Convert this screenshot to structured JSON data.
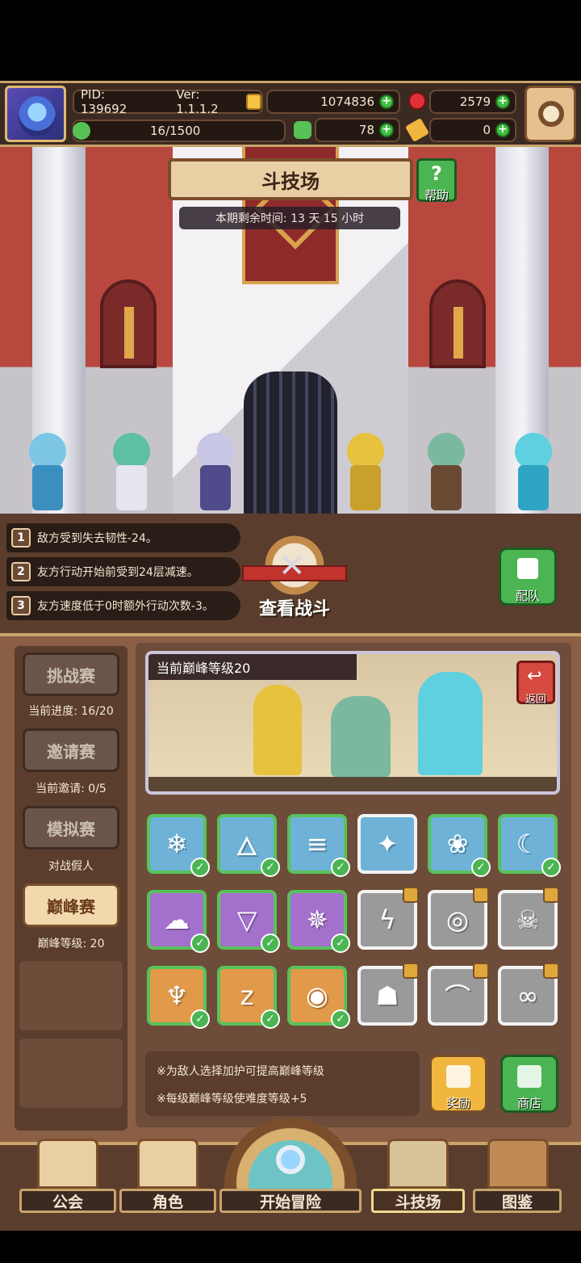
{
  "header": {
    "pid": "PID: 139692",
    "version": "Ver: 1.1.1.2",
    "gold": "1074836",
    "gems": "2579",
    "stamina": "16/1500",
    "clover": "78",
    "keys": "0"
  },
  "arena": {
    "title": "斗技场",
    "help_label": "帮助",
    "help_glyph": "?",
    "timer": "本期剩余时间: 13 天 15 小时"
  },
  "buffs": [
    {
      "num": "1",
      "text": "敌方受到失去韧性-24。"
    },
    {
      "num": "2",
      "text": "友方行动开始前受到24层减速。"
    },
    {
      "num": "3",
      "text": "友方速度低于0时额外行动次数-3。"
    }
  ],
  "battle": {
    "view_label": "查看战斗",
    "team_label": "配队"
  },
  "modes": [
    {
      "label": "挑战赛",
      "sub": "当前进度: 16/20",
      "active": false
    },
    {
      "label": "邀请赛",
      "sub": "当前邀请: 0/5",
      "active": false
    },
    {
      "label": "模拟赛",
      "sub": "对战假人",
      "active": false
    },
    {
      "label": "巅峰赛",
      "sub": "巅峰等级: 20",
      "active": true
    }
  ],
  "peak": {
    "current_label": "当前巅峰等级20",
    "return_label": "返回",
    "return_glyph": "↩"
  },
  "modifiers": [
    {
      "icon": "snowflake-icon",
      "glyph": "❄",
      "color": "blue",
      "checked": true,
      "locked": false
    },
    {
      "icon": "flame-icon",
      "glyph": "🜂",
      "color": "blue",
      "checked": true,
      "locked": false
    },
    {
      "icon": "tornado-icon",
      "glyph": "≡",
      "color": "blue",
      "checked": true,
      "locked": false
    },
    {
      "icon": "sparkle-icon",
      "glyph": "✦",
      "color": "blue",
      "checked": false,
      "locked": false
    },
    {
      "icon": "paw-icon",
      "glyph": "❀",
      "color": "blue",
      "checked": true,
      "locked": false
    },
    {
      "icon": "claw-icon",
      "glyph": "☾",
      "color": "blue",
      "checked": true,
      "locked": false
    },
    {
      "icon": "mushroom-cloud-icon",
      "glyph": "☁",
      "color": "purple",
      "checked": true,
      "locked": false
    },
    {
      "icon": "triangle-eye-icon",
      "glyph": "▽",
      "color": "purple",
      "checked": true,
      "locked": false
    },
    {
      "icon": "burst-icon",
      "glyph": "✵",
      "color": "purple",
      "checked": true,
      "locked": false
    },
    {
      "icon": "lightning-icon",
      "glyph": "ϟ",
      "color": "grey",
      "checked": false,
      "locked": true
    },
    {
      "icon": "ring-icon",
      "glyph": "◎",
      "color": "grey",
      "checked": false,
      "locked": true
    },
    {
      "icon": "skull-icon",
      "glyph": "☠",
      "color": "grey",
      "checked": false,
      "locked": true
    },
    {
      "icon": "shell-icon",
      "glyph": "♆",
      "color": "orange",
      "checked": true,
      "locked": false
    },
    {
      "icon": "sleep-icon",
      "glyph": "z",
      "color": "orange",
      "checked": true,
      "locked": false
    },
    {
      "icon": "swirl-icon",
      "glyph": "◉",
      "color": "orange",
      "checked": true,
      "locked": false
    },
    {
      "icon": "ghost-icon",
      "glyph": "☗",
      "color": "grey",
      "checked": false,
      "locked": true
    },
    {
      "icon": "pickaxe-icon",
      "glyph": "⌒",
      "color": "grey",
      "checked": false,
      "locked": true
    },
    {
      "icon": "infinity-icon",
      "glyph": "∞",
      "color": "grey",
      "checked": false,
      "locked": true
    }
  ],
  "notes": [
    "※为敌人选择加护可提高巅峰等级",
    "※每级巅峰等级使难度等级+5"
  ],
  "side_buttons": {
    "reward_label": "奖励",
    "shop_label": "商店"
  },
  "nav": {
    "guild": "公会",
    "characters": "角色",
    "adventure": "开始冒险",
    "arena": "斗技场",
    "codex": "图鉴"
  }
}
